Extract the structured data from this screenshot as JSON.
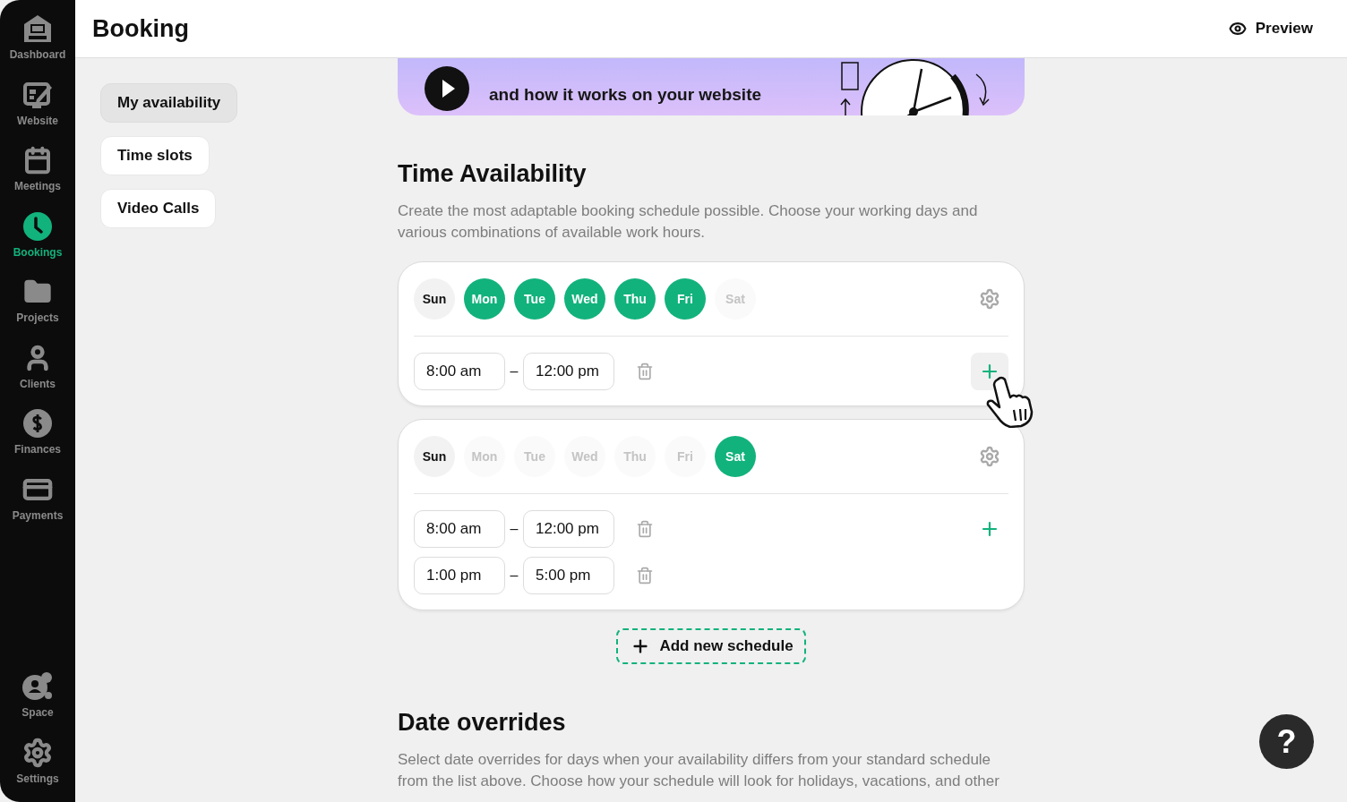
{
  "sidebar": {
    "items": [
      {
        "label": "Dashboard",
        "kind": "home",
        "selected": false
      },
      {
        "label": "Website",
        "kind": "website",
        "selected": false
      },
      {
        "label": "Meetings",
        "kind": "calendar",
        "selected": false
      },
      {
        "label": "Bookings",
        "kind": "clock",
        "selected": true
      },
      {
        "label": "Projects",
        "kind": "folder",
        "selected": false
      },
      {
        "label": "Clients",
        "kind": "user",
        "selected": false
      },
      {
        "label": "Finances",
        "kind": "dollar",
        "selected": false
      },
      {
        "label": "Payments",
        "kind": "card",
        "selected": false
      }
    ],
    "bottom_items": [
      {
        "label": "Space",
        "kind": "space",
        "selected": false
      },
      {
        "label": "Settings",
        "kind": "gear",
        "selected": false
      }
    ]
  },
  "header": {
    "title": "Booking",
    "preview": "Preview"
  },
  "subnav": [
    {
      "label": "My availability",
      "selected": true
    },
    {
      "label": "Time slots",
      "selected": false
    },
    {
      "label": "Video Calls",
      "selected": false
    }
  ],
  "banner": {
    "text": "and how it works on your website"
  },
  "time_availability": {
    "title": "Time Availability",
    "description": "Create the most adaptable booking schedule possible. Choose your working days and various combinations of available work hours.",
    "schedules": [
      {
        "days": [
          {
            "label": "Sun",
            "selected": false,
            "disabled": false
          },
          {
            "label": "Mon",
            "selected": true,
            "disabled": false
          },
          {
            "label": "Tue",
            "selected": true,
            "disabled": false
          },
          {
            "label": "Wed",
            "selected": true,
            "disabled": false
          },
          {
            "label": "Thu",
            "selected": true,
            "disabled": false
          },
          {
            "label": "Fri",
            "selected": true,
            "disabled": false
          },
          {
            "label": "Sat",
            "selected": false,
            "disabled": true
          }
        ],
        "add_hovered": true,
        "ranges": [
          {
            "start": "8:00 am",
            "separator": "–",
            "end": "12:00 pm"
          }
        ]
      },
      {
        "days": [
          {
            "label": "Sun",
            "selected": false,
            "disabled": false
          },
          {
            "label": "Mon",
            "selected": false,
            "disabled": true
          },
          {
            "label": "Tue",
            "selected": false,
            "disabled": true
          },
          {
            "label": "Wed",
            "selected": false,
            "disabled": true
          },
          {
            "label": "Thu",
            "selected": false,
            "disabled": true
          },
          {
            "label": "Fri",
            "selected": false,
            "disabled": true
          },
          {
            "label": "Sat",
            "selected": true,
            "disabled": false
          }
        ],
        "add_hovered": false,
        "ranges": [
          {
            "start": "8:00 am",
            "separator": "–",
            "end": "12:00 pm"
          },
          {
            "start": "1:00 pm",
            "separator": "–",
            "end": "5:00 pm"
          }
        ]
      }
    ],
    "add_button": "Add new schedule"
  },
  "date_overrides": {
    "title": "Date overrides",
    "lines": [
      "Select date overrides for days when your availability differs from your standard schedule",
      "from the list above. Choose how your schedule will look for holidays, vacations, and other"
    ]
  },
  "help_button": "?"
}
